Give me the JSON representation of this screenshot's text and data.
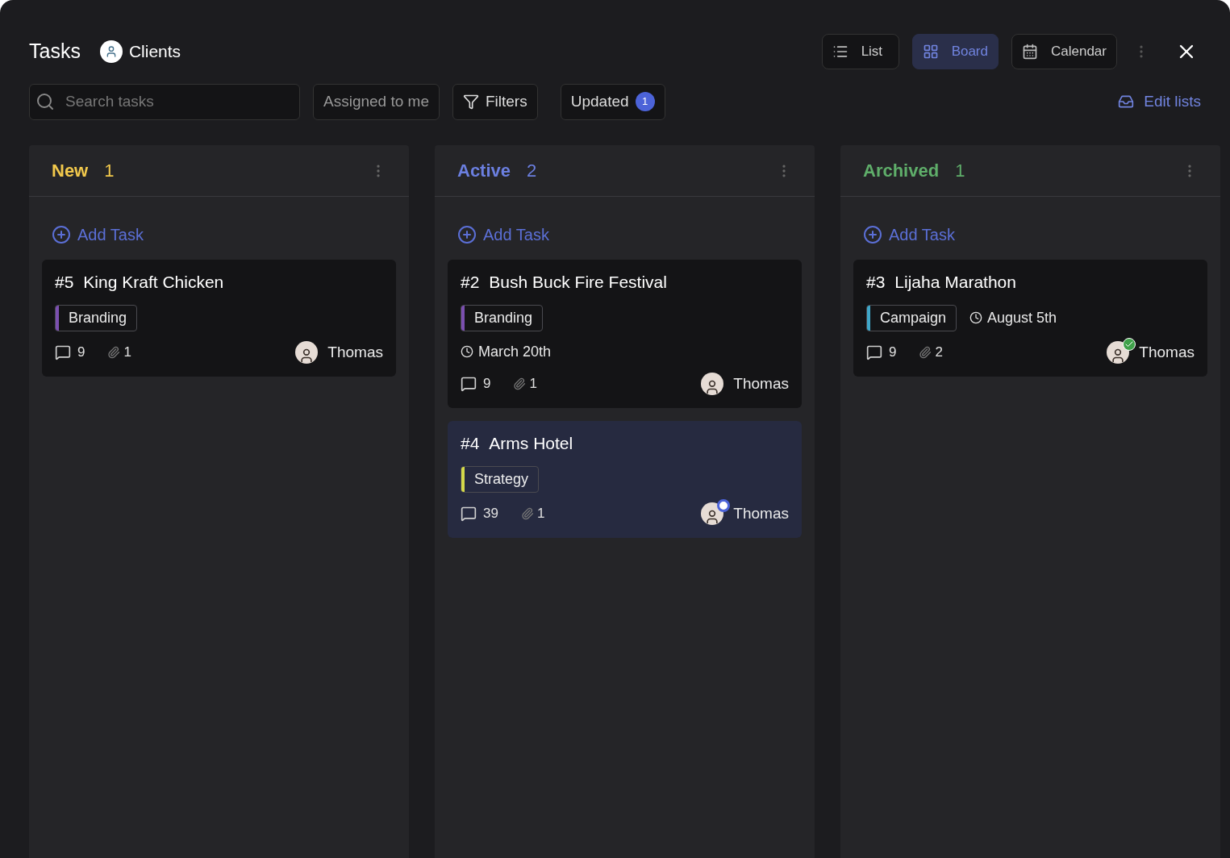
{
  "header": {
    "title": "Tasks",
    "project": "Clients"
  },
  "views": [
    {
      "label": "List",
      "kind": "list",
      "selected": false
    },
    {
      "label": "Board",
      "kind": "board",
      "selected": true
    },
    {
      "label": "Calendar",
      "kind": "calendar",
      "selected": false
    }
  ],
  "toolbar": {
    "search": {
      "placeholder": "Search tasks"
    },
    "assigned": "Assigned to me",
    "filters": "Filters",
    "updated": {
      "label": "Updated",
      "count": "1"
    },
    "edit_lists": "Edit lists"
  },
  "columns": [
    {
      "name": "New",
      "count": "1",
      "color": "#f2c94c",
      "add_label": "Add Task",
      "cards": [
        {
          "kind": "basic",
          "number": "#5",
          "title": "King Kraft Chicken",
          "tag": {
            "label": "Branding",
            "color": "#7b4fb0"
          },
          "comments": "9",
          "attachments": "1",
          "assignee": "Thomas",
          "in_progress": false,
          "completed": false,
          "selected": false
        }
      ]
    },
    {
      "name": "Active",
      "count": "2",
      "color": "#6b7fe0",
      "add_label": "Add Task",
      "cards": [
        {
          "kind": "dated",
          "number": "#2",
          "title": "Bush Buck Fire Festival",
          "tag": {
            "label": "Branding",
            "color": "#7b4fb0"
          },
          "due": "March 20th",
          "comments": "9",
          "attachments": "1",
          "assignee": "Thomas",
          "in_progress": false,
          "completed": false,
          "selected": false
        },
        {
          "kind": "basic",
          "number": "#4",
          "title": "Arms Hotel",
          "tag": {
            "label": "Strategy",
            "color": "#d4d94a"
          },
          "comments": "39",
          "attachments": "1",
          "assignee": "Thomas",
          "in_progress": true,
          "completed": false,
          "selected": true
        }
      ]
    },
    {
      "name": "Archived",
      "count": "1",
      "color": "#5fae6a",
      "add_label": "Add Task",
      "cards": [
        {
          "kind": "dated_inline",
          "number": "#3",
          "title": "Lijaha Marathon",
          "tag": {
            "label": "Campaign",
            "color": "#3fa7c9"
          },
          "due": "August 5th",
          "comments": "9",
          "attachments": "2",
          "assignee": "Thomas",
          "in_progress": false,
          "completed": true,
          "selected": false
        }
      ]
    }
  ]
}
